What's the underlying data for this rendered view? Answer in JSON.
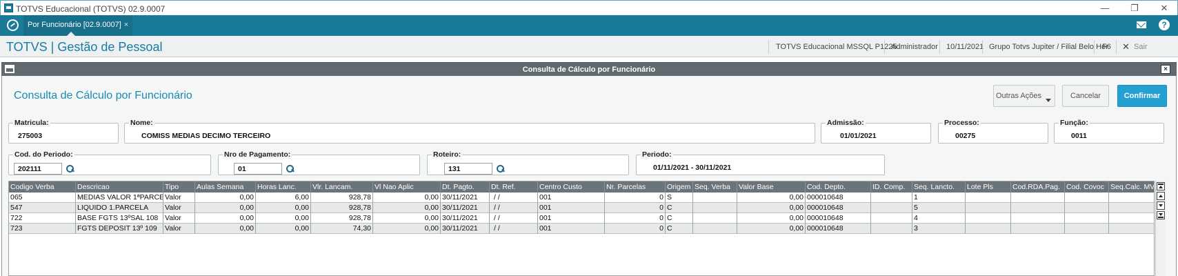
{
  "window": {
    "title": "TOTVS Educacional (TOTVS) 02.9.0007",
    "min": "—",
    "restore": "❐",
    "close": "✕"
  },
  "tabs": [
    {
      "label": "Por Funcionário [02.9.0007]",
      "close": "×"
    }
  ],
  "app": {
    "brand": "TOTVS | Gestão de Pessoal",
    "environment": "TOTVS Educacional MSSQL P1225",
    "user": "Administrador",
    "date": "10/11/2021",
    "branch": "Grupo Totvs Jupiter / Filial Belo Hor",
    "shortcut": "F6",
    "exit_label": "Sair",
    "exit_icon": "✕"
  },
  "dialog": {
    "title": "Consulta de Cálculo por Funcionário",
    "close": "×"
  },
  "form": {
    "title": "Consulta de Cálculo por Funcionário",
    "buttons": {
      "other": "Outras Ações",
      "cancel": "Cancelar",
      "confirm": "Confirmar"
    },
    "fields": {
      "matricula": {
        "label": "Matricula:",
        "value": "275003"
      },
      "nome": {
        "label": "Nome:",
        "value": "COMISS MEDIAS DECIMO TERCEIRO"
      },
      "admissao": {
        "label": "Admissão:",
        "value": "01/01/2021"
      },
      "processo": {
        "label": "Processo:",
        "value": "00275"
      },
      "funcao": {
        "label": "Função:",
        "value": "0011"
      },
      "cod_periodo": {
        "label": "Cod. do Periodo:",
        "value": "202111"
      },
      "nro_pagamento": {
        "label": "Nro de Pagamento:",
        "value": "01"
      },
      "roteiro": {
        "label": "Roteiro:",
        "value": "131"
      },
      "periodo": {
        "label": "Periodo:",
        "value": "01/11/2021 - 30/11/2021"
      }
    }
  },
  "grid": {
    "columns": [
      "Codigo Verba",
      "Descricao",
      "Tipo",
      "Aulas Semana",
      "Horas Lanc.",
      "Vlr. Lancam.",
      "Vl Nao Aplic",
      "Dt. Pagto.",
      "Dt. Ref.",
      "Centro Custo",
      "Nr. Parcelas",
      "Origem",
      "Seq. Verba",
      "Valor Base",
      "Cod. Depto.",
      "ID. Comp.",
      "Seq. Lancto.",
      "Lote Pls",
      "Cod.RDA.Pag.",
      "Cod. Covoc",
      "Seq.Calc. MV"
    ],
    "rows": [
      [
        "065",
        "MEDIAS VALOR 1ªPARCE",
        "Valor",
        "0,00",
        "6,00",
        "928,78",
        "0,00",
        "30/11/2021",
        "/ /",
        "001",
        "0",
        "S",
        "",
        "0,00",
        "000010648",
        "",
        "1",
        "",
        "",
        "",
        ""
      ],
      [
        "547",
        "LIQUIDO 1.PARCELA",
        "Valor",
        "0,00",
        "0,00",
        "928,78",
        "0,00",
        "30/11/2021",
        "/ /",
        "001",
        "0",
        "C",
        "",
        "0,00",
        "000010648",
        "",
        "5",
        "",
        "",
        "",
        ""
      ],
      [
        "722",
        "BASE FGTS 13ºSAL 108",
        "Valor",
        "0,00",
        "0,00",
        "928,78",
        "0,00",
        "30/11/2021",
        "/ /",
        "001",
        "0",
        "C",
        "",
        "0,00",
        "000010648",
        "",
        "4",
        "",
        "",
        "",
        ""
      ],
      [
        "723",
        "FGTS DEPOSIT 13º 109",
        "Valor",
        "0,00",
        "0,00",
        "74,30",
        "0,00",
        "30/11/2021",
        "/ /",
        "001",
        "0",
        "C",
        "",
        "0,00",
        "000010648",
        "",
        "3",
        "",
        "",
        "",
        ""
      ]
    ]
  },
  "colors": {
    "header_bar": "#1a7b98",
    "accent": "#25a0d2",
    "grid_header": "#6b7478",
    "row_alt": "#e6e8e9"
  }
}
